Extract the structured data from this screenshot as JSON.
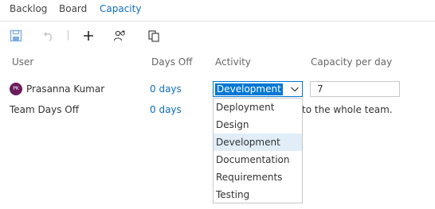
{
  "tabs": [
    {
      "label": "Backlog",
      "active": false
    },
    {
      "label": "Board",
      "active": false
    },
    {
      "label": "Capacity",
      "active": true
    }
  ],
  "toolbar": {
    "icons": [
      "save-icon",
      "undo-icon",
      "add-icon",
      "add-team-members-icon",
      "copy-icon"
    ]
  },
  "table": {
    "headers": {
      "user": "User",
      "days_off": "Days Off",
      "activity": "Activity",
      "capacity": "Capacity per day"
    },
    "rows": [
      {
        "avatar_initials": "PK",
        "user": "Prasanna Kumar",
        "days_off": "0 days",
        "activity": "Development",
        "capacity": "7"
      }
    ],
    "team_days_off": {
      "label": "Team Days Off",
      "days": "0 days",
      "note_visible": "to the whole team."
    }
  },
  "activity_dropdown": {
    "options": [
      "Deployment",
      "Design",
      "Development",
      "Documentation",
      "Requirements",
      "Testing"
    ],
    "selected": "Development"
  },
  "colors": {
    "accent": "#0078d4",
    "link": "#106ebe",
    "avatar_bg": "#6b1c5c",
    "selected_option_bg": "#e1eef8"
  }
}
